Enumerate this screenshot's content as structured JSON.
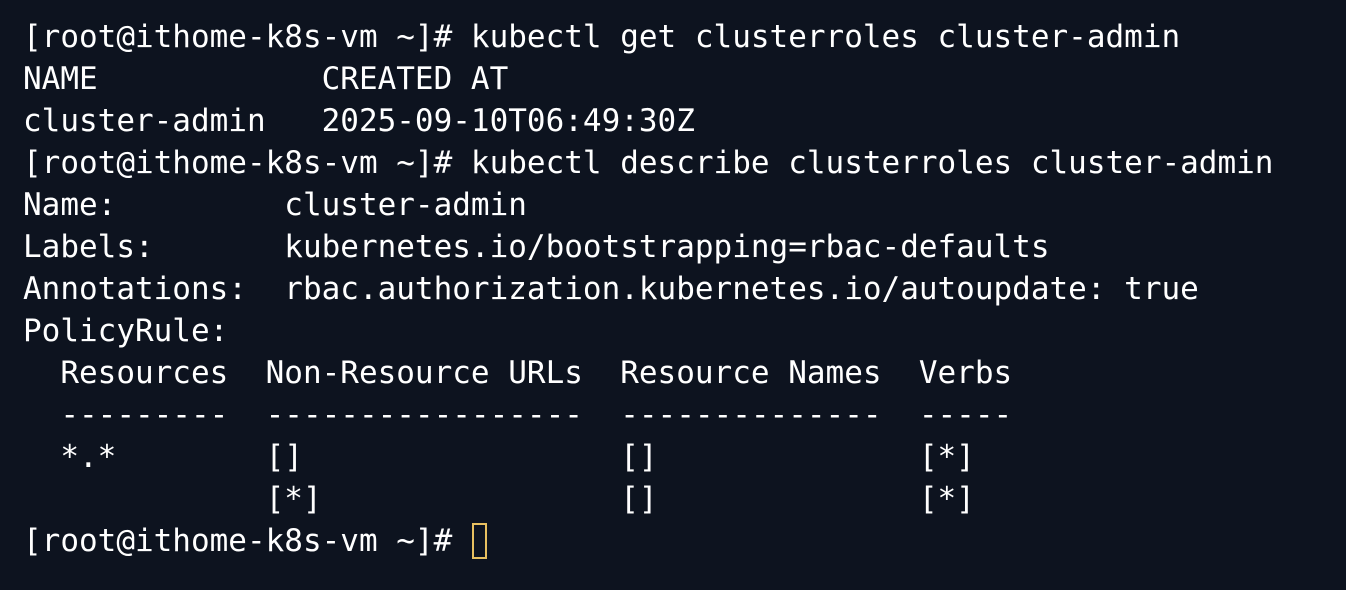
{
  "terminal": {
    "lines": [
      "[root@ithome-k8s-vm ~]# kubectl get clusterroles cluster-admin",
      "NAME            CREATED AT",
      "cluster-admin   2025-09-10T06:49:30Z",
      "[root@ithome-k8s-vm ~]# kubectl describe clusterroles cluster-admin",
      "Name:         cluster-admin",
      "Labels:       kubernetes.io/bootstrapping=rbac-defaults",
      "Annotations:  rbac.authorization.kubernetes.io/autoupdate: true",
      "PolicyRule:",
      "  Resources  Non-Resource URLs  Resource Names  Verbs",
      "  ---------  -----------------  --------------  -----",
      "  *.*        []                 []              [*]",
      "             [*]                []              [*]"
    ],
    "prompt": "[root@ithome-k8s-vm ~]#",
    "cursor_color": "#e8c060",
    "background_color": "#0d131f",
    "text_color": "#ffffff"
  }
}
